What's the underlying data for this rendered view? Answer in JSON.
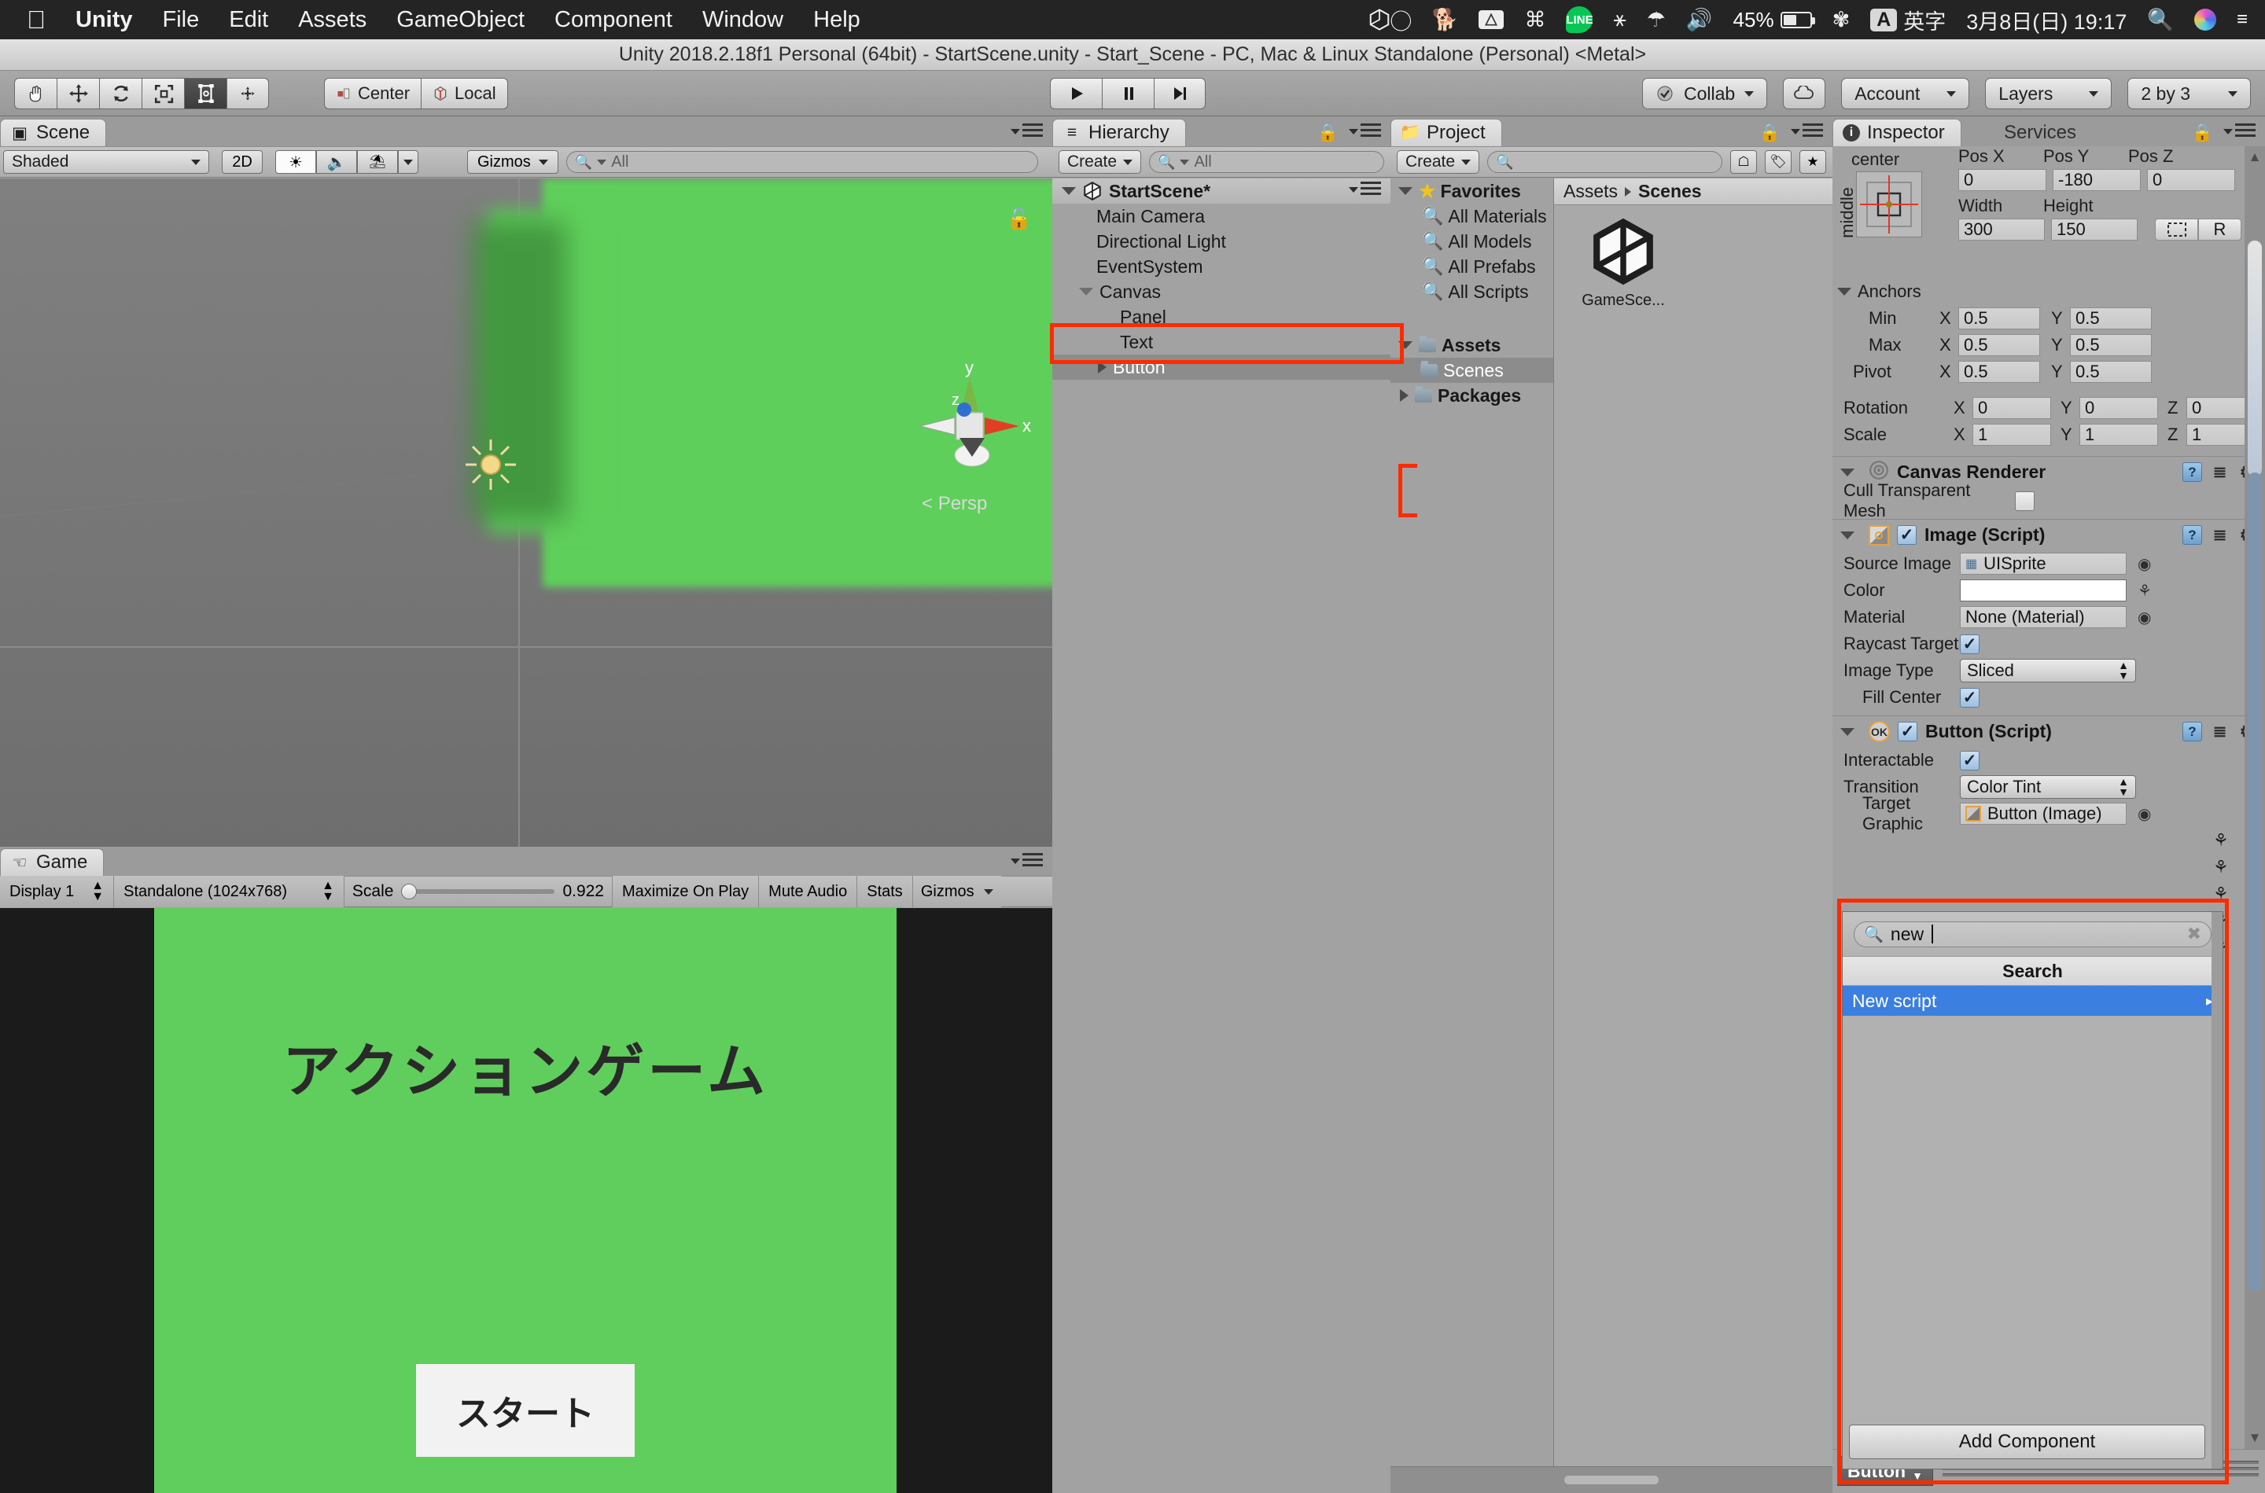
{
  "macbar": {
    "apple_icon": "apple-icon",
    "menus": [
      {
        "label": "Unity",
        "bold": true
      },
      {
        "label": "File",
        "bold": false
      },
      {
        "label": "Edit",
        "bold": false
      },
      {
        "label": "Assets",
        "bold": false
      },
      {
        "label": "GameObject",
        "bold": false
      },
      {
        "label": "Component",
        "bold": false
      },
      {
        "label": "Window",
        "bold": false
      },
      {
        "label": "Help",
        "bold": false
      }
    ],
    "status_icons": [
      "unity-icon",
      "glasses-icon",
      "dog-icon",
      "drive-icon",
      "command-icon",
      "line-icon",
      "accessibility-icon",
      "wifi-icon",
      "volume-icon"
    ],
    "battery_percent": "45%",
    "bluetooth_icon": "bluetooth-icon",
    "input_source": "英字",
    "input_badge": "A",
    "datetime": "3月8日(日) 19:17",
    "search_icon": "search-icon",
    "siri_icon": "siri-icon",
    "controlcenter_icon": "list-icon"
  },
  "titlebar": {
    "title": "Unity 2018.2.18f1 Personal (64bit) - StartScene.unity - Start_Scene - PC, Mac & Linux Standalone (Personal) <Metal>"
  },
  "toolbar": {
    "transform_tools": [
      {
        "name": "hand-tool",
        "glyph": "✋",
        "active": false
      },
      {
        "name": "move-tool",
        "glyph": "✥",
        "active": false
      },
      {
        "name": "rotate-tool",
        "glyph": "⟳",
        "active": false
      },
      {
        "name": "scale-tool",
        "glyph": "⤢",
        "active": false
      },
      {
        "name": "rect-tool",
        "glyph": "▣",
        "active": true
      },
      {
        "name": "transform-tool",
        "glyph": "✣",
        "active": false
      }
    ],
    "pivot_label": "Center",
    "space_label": "Local",
    "play_buttons": [
      {
        "name": "play-button",
        "glyph": "▶"
      },
      {
        "name": "pause-button",
        "glyph": "❚❚"
      },
      {
        "name": "step-button",
        "glyph": "▶❙"
      }
    ],
    "collab_label": "Collab",
    "cloud_icon": "cloud-icon",
    "account_label": "Account",
    "layers_label": "Layers",
    "layout_label": "2 by 3"
  },
  "scene": {
    "tab_label": "Scene",
    "tab_icon": "grid-icon",
    "shading_mode": "Shaded",
    "toggle_2d": "2D",
    "toggles": [
      {
        "name": "lighting-toggle",
        "glyph": "☀",
        "lit": true
      },
      {
        "name": "audio-toggle",
        "glyph": "🔊",
        "lit": false
      },
      {
        "name": "effects-toggle",
        "glyph": "▣",
        "lit": false
      }
    ],
    "gizmos_label": "Gizmos",
    "search_placeholder": "All",
    "axis_labels": [
      "y",
      "x",
      "z"
    ],
    "perspective_label": "Persp"
  },
  "game": {
    "tab_label": "Game",
    "tab_icon": "gamepad-icon",
    "display": "Display 1",
    "resolution": "Standalone (1024x768)",
    "scale_label": "Scale",
    "scale_value": "0.922",
    "maximize_label": "Maximize On Play",
    "mute_label": "Mute Audio",
    "stats_label": "Stats",
    "gizmos_label": "Gizmos",
    "canvas": {
      "bg_color": "#60ce5c",
      "title_text": "アクションゲーム",
      "button_text": "スタート"
    }
  },
  "hierarchy": {
    "tab_label": "Hierarchy",
    "tab_icon": "list-icon",
    "create_label": "Create",
    "search_placeholder": "All",
    "scene_name": "StartScene*",
    "items": [
      {
        "label": "Main Camera",
        "depth": 1,
        "expandable": false,
        "selected": false
      },
      {
        "label": "Directional Light",
        "depth": 1,
        "expandable": false,
        "selected": false
      },
      {
        "label": "EventSystem",
        "depth": 1,
        "expandable": false,
        "selected": false
      },
      {
        "label": "Canvas",
        "depth": 1,
        "expandable": true,
        "expanded": true,
        "selected": false
      },
      {
        "label": "Panel",
        "depth": 2,
        "expandable": false,
        "selected": false
      },
      {
        "label": "Text",
        "depth": 2,
        "expandable": false,
        "selected": false
      },
      {
        "label": "Button",
        "depth": 2,
        "expandable": true,
        "expanded": false,
        "selected": true
      }
    ]
  },
  "project": {
    "tab_label": "Project",
    "tab_icon": "folder-icon",
    "create_label": "Create",
    "search_placeholder": "",
    "tree": [
      {
        "label": "Favorites",
        "icon": "star-icon",
        "depth": 0,
        "bold": true,
        "selected": false
      },
      {
        "label": "All Materials",
        "icon": "magnifier-icon",
        "depth": 1,
        "bold": false,
        "selected": false
      },
      {
        "label": "All Models",
        "icon": "magnifier-icon",
        "depth": 1,
        "bold": false,
        "selected": false
      },
      {
        "label": "All Prefabs",
        "icon": "magnifier-icon",
        "depth": 1,
        "bold": false,
        "selected": false
      },
      {
        "label": "All Scripts",
        "icon": "magnifier-icon",
        "depth": 1,
        "bold": false,
        "selected": false
      },
      {
        "label": "Assets",
        "icon": "folder-icon",
        "depth": 0,
        "bold": true,
        "selected": false
      },
      {
        "label": "Scenes",
        "icon": "folder-icon",
        "depth": 1,
        "bold": false,
        "selected": true
      },
      {
        "label": "Packages",
        "icon": "folder-icon",
        "depth": 0,
        "bold": true,
        "selected": false
      }
    ],
    "breadcrumb": [
      "Assets",
      "Scenes"
    ],
    "assets": [
      {
        "label": "GameSce...",
        "icon": "unity-scene-icon"
      }
    ]
  },
  "inspector": {
    "tabs": [
      {
        "label": "Inspector",
        "active": true,
        "icon": "info-icon"
      },
      {
        "label": "Services",
        "active": false,
        "icon": ""
      }
    ],
    "rect_transform": {
      "anchor_preset_h": "center",
      "anchor_preset_v": "middle",
      "pos_labels": [
        "Pos X",
        "Pos Y",
        "Pos Z"
      ],
      "pos_values": [
        "0",
        "-180",
        "0"
      ],
      "size_labels": [
        "Width",
        "Height"
      ],
      "size_values": [
        "300",
        "150"
      ],
      "blueprint_icon": "blueprint-icon",
      "raw_label": "R",
      "anchors_label": "Anchors",
      "anchors": [
        {
          "label": "Min",
          "x": "0.5",
          "y": "0.5"
        },
        {
          "label": "Max",
          "x": "0.5",
          "y": "0.5"
        },
        {
          "label": "Pivot",
          "x": "0.5",
          "y": "0.5"
        }
      ],
      "rotation_label": "Rotation",
      "rotation": [
        "0",
        "0",
        "0"
      ],
      "scale_label": "Scale",
      "scale": [
        "1",
        "1",
        "1"
      ]
    },
    "canvas_renderer": {
      "title": "Canvas Renderer",
      "cull_label": "Cull Transparent Mesh",
      "cull_checked": false
    },
    "image_script": {
      "title": "Image (Script)",
      "enabled": true,
      "rows": [
        {
          "label": "Source Image",
          "value": "UISprite",
          "type": "object"
        },
        {
          "label": "Color",
          "value": "",
          "type": "color",
          "color": "#ffffff"
        },
        {
          "label": "Material",
          "value": "None (Material)",
          "type": "object"
        },
        {
          "label": "Raycast Target",
          "value": "",
          "type": "checkbox",
          "checked": true
        },
        {
          "label": "Image Type",
          "value": "Sliced",
          "type": "select"
        },
        {
          "label": "Fill Center",
          "value": "",
          "type": "checkbox",
          "checked": true
        }
      ]
    },
    "button_script": {
      "title": "Button (Script)",
      "badge": "OK",
      "enabled": true,
      "rows": [
        {
          "label": "Interactable",
          "value": "",
          "type": "checkbox",
          "checked": true
        },
        {
          "label": "Transition",
          "value": "Color Tint",
          "type": "select"
        },
        {
          "label": "Target Graphic",
          "value": "Button (Image)",
          "type": "object"
        }
      ]
    },
    "component_search": {
      "query": "new",
      "search_icon": "search-icon",
      "clear_icon": "clear-icon",
      "header": "Search",
      "results": [
        {
          "label": "New script",
          "selected": true,
          "has_submenu": true
        }
      ],
      "add_component_label": "Add Component"
    },
    "footer_tag": "Button"
  }
}
